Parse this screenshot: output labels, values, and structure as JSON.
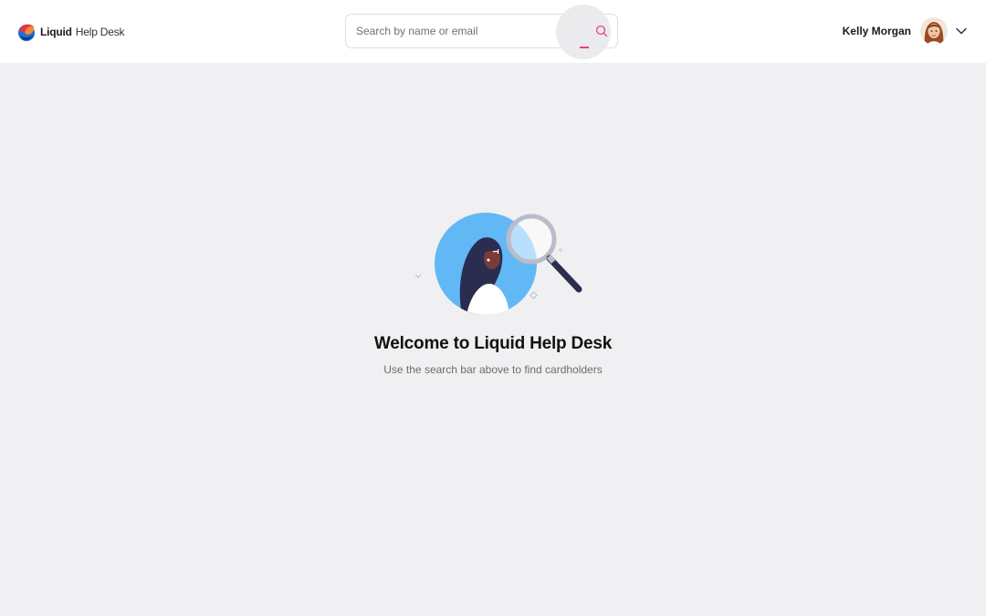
{
  "header": {
    "brand_name": "Liquid",
    "brand_sub": "Help Desk",
    "search_placeholder": "Search by name or email",
    "user_name": "Kelly Morgan"
  },
  "main": {
    "title": "Welcome to Liquid Help Desk",
    "subtitle": "Use the search bar above to find cardholders"
  },
  "icons": {
    "logo": "liquid-logo",
    "search": "search-icon",
    "chevron": "chevron-down-icon",
    "hero": "search-person-illustration"
  },
  "colors": {
    "accent": "#e83e8c",
    "hero_blue": "#62b8f5",
    "navy": "#2a2d4f",
    "background": "#f0f0f2"
  }
}
